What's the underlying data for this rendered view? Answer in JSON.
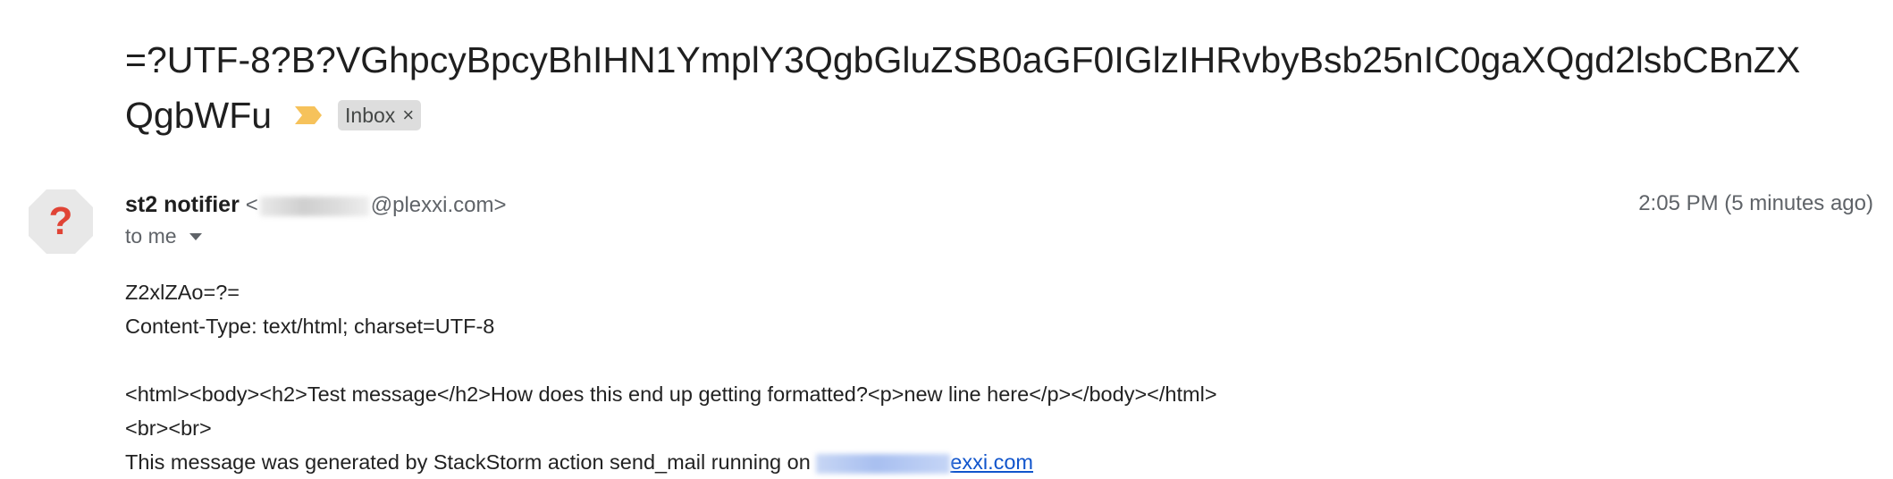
{
  "email": {
    "subject_line1": "=?UTF-8?B?VGhpcyBpcyBhIHN1YmplY3QgbGluZSB0aGF0IGlzIHRvbyBsb25nIC0gaXQgd2lsbCBnZX",
    "subject_line2": "QgbWFu",
    "label": "Inbox",
    "label_remove": "×",
    "sender_name": "st2 notifier",
    "sender_email_prefix": "<",
    "sender_email_domain": "@plexxi.com>",
    "recipient": "to me",
    "timestamp": "2:05 PM (5 minutes ago)",
    "avatar_glyph": "?",
    "body_lines": [
      "Z2xlZAo=?=",
      "Content-Type: text/html; charset=UTF-8",
      "<html><body><h2>Test message</h2>How does this end up getting formatted?<p>new line here</p></body></html>",
      "<br><br>"
    ],
    "footer_text": "This message was generated by StackStorm action send_mail running on ",
    "footer_link_suffix": "exxi.com"
  },
  "colors": {
    "important_marker": "#f6c25b",
    "avatar_bg": "#e8e8e8",
    "avatar_glyph": "#e04436",
    "link": "#1155cc"
  },
  "icons": {
    "important": "important-marker-icon",
    "label_remove": "close-icon",
    "recipient_details": "chevron-down-icon",
    "avatar": "unknown-sender-avatar"
  }
}
